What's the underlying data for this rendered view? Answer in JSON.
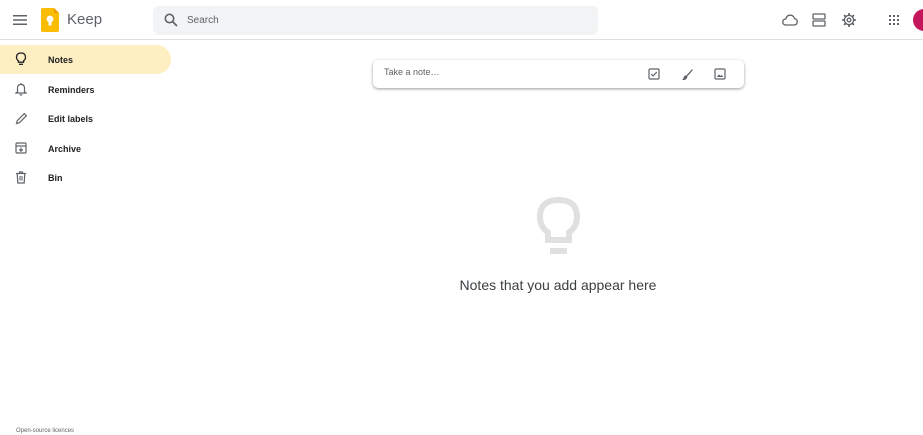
{
  "header": {
    "app_title": "Keep",
    "search_placeholder": "Search",
    "icons": [
      "menu-icon",
      "keep-logo-icon",
      "search-icon",
      "cloud-icon",
      "list-view-icon",
      "settings-icon",
      "apps-grid-icon",
      "avatar"
    ]
  },
  "sidebar": {
    "items": [
      {
        "label": "Notes",
        "icon": "lightbulb-icon",
        "active": true
      },
      {
        "label": "Reminders",
        "icon": "bell-icon",
        "active": false
      },
      {
        "label": "Edit labels",
        "icon": "pencil-icon",
        "active": false
      },
      {
        "label": "Archive",
        "icon": "archive-icon",
        "active": false
      },
      {
        "label": "Bin",
        "icon": "trash-icon",
        "active": false
      }
    ],
    "footer_link": "Open-source licences"
  },
  "note_bar": {
    "placeholder": "Take a note…",
    "icons": [
      "new-list-icon",
      "new-drawing-icon",
      "new-image-icon"
    ]
  },
  "empty_state": {
    "icon": "lightbulb-icon",
    "message": "Notes that you add appear here"
  },
  "colors": {
    "active_nav": "#feefc3",
    "logo_yellow": "#fbbc04",
    "avatar": "#c2185b",
    "search_bg": "#f1f3f4"
  }
}
